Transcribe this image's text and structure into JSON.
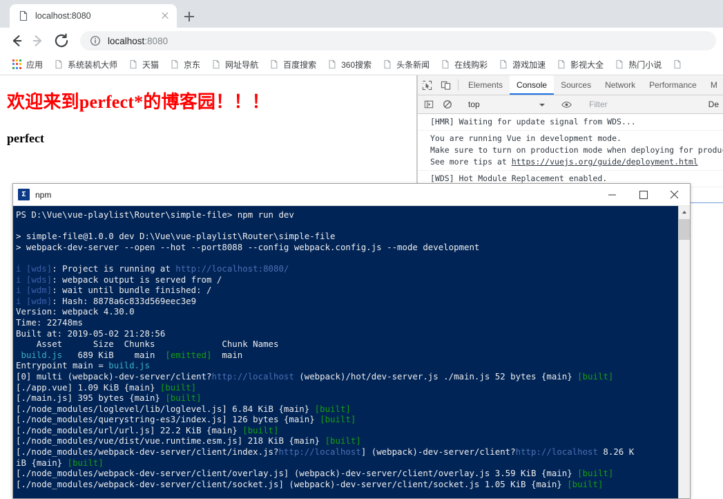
{
  "browser": {
    "tab": {
      "title": "localhost:8080",
      "favicon": "page-icon",
      "close": "close-icon"
    },
    "new_tab": "+",
    "nav": {
      "back": "back-arrow-icon",
      "forward": "forward-arrow-icon",
      "reload": "reload-icon"
    },
    "omnibox": {
      "info_icon": "info-circle-icon",
      "host": "localhost",
      "port": ":8080"
    },
    "bookmarks": [
      {
        "label": "应用",
        "icon": "apps-grid-icon"
      },
      {
        "label": "系统装机大师",
        "icon": "page-icon"
      },
      {
        "label": "天猫",
        "icon": "page-icon"
      },
      {
        "label": "京东",
        "icon": "page-icon"
      },
      {
        "label": "网址导航",
        "icon": "page-icon"
      },
      {
        "label": "百度搜索",
        "icon": "page-icon"
      },
      {
        "label": "360搜索",
        "icon": "page-icon"
      },
      {
        "label": "头条新闻",
        "icon": "page-icon"
      },
      {
        "label": "在线购彩",
        "icon": "page-icon"
      },
      {
        "label": "游戏加速",
        "icon": "page-icon"
      },
      {
        "label": "影视大全",
        "icon": "page-icon"
      },
      {
        "label": "热门小说",
        "icon": "page-icon"
      },
      {
        "label": "",
        "icon": "page-icon"
      }
    ]
  },
  "page": {
    "heading": "欢迎来到perfect*的博客园！！！",
    "subheading": "perfect",
    "heading_color": "#ff0000"
  },
  "devtools": {
    "icons": {
      "inspect": "inspect-cursor-icon",
      "device": "device-toolbar-icon",
      "sidebar": "sidebar-toggle-icon",
      "clear": "clear-console-icon",
      "eye": "eye-icon"
    },
    "tabs": [
      {
        "label": "Elements",
        "active": false
      },
      {
        "label": "Console",
        "active": true
      },
      {
        "label": "Sources",
        "active": false
      },
      {
        "label": "Network",
        "active": false
      },
      {
        "label": "Performance",
        "active": false
      },
      {
        "label": "M",
        "active": false
      }
    ],
    "context": "top",
    "filter_placeholder": "Filter",
    "levels": "De",
    "messages": [
      {
        "lines": [
          "[HMR] Waiting for update signal from WDS..."
        ]
      },
      {
        "lines": [
          "You are running Vue in development mode.",
          "Make sure to turn on production mode when deploying for producti",
          "See more tips at https://vuejs.org/guide/deployment.html"
        ],
        "link": "https://vuejs.org/guide/deployment.html"
      },
      {
        "lines": [
          "[WDS] Hot Module Replacement enabled."
        ]
      }
    ],
    "prompt": ">"
  },
  "terminal": {
    "title": "npm",
    "icon_glyph": "Σ",
    "controls": {
      "minimize": "minimize-icon",
      "maximize": "maximize-icon",
      "close": "close-icon"
    },
    "lines": [
      "PS D:\\Vue\\vue-playlist\\Router\\simple-file> npm run dev",
      "",
      "> simple-file@1.0.0 dev D:\\Vue\\vue-playlist\\Router\\simple-file",
      "> webpack-dev-server --open --hot --port8088 --config webpack.config.js --mode development",
      "",
      "i [wds]: Project is running at http://localhost:8080/",
      "i [wds]: webpack output is served from /",
      "i [wdm]: wait until bundle finished: /",
      "i [wdm]: Hash: 8878a6c833d569eec3e9",
      "Version: webpack 4.30.0",
      "Time: 22748ms",
      "Built at: 2019-05-02 21:28:56",
      "    Asset      Size  Chunks             Chunk Names",
      " build.js   689 KiB    main  [emitted]  main",
      "Entrypoint main = build.js",
      "[0] multi (webpack)-dev-server/client?http://localhost (webpack)/hot/dev-server.js ./main.js 52 bytes {main} [built]",
      "[./app.vue] 1.09 KiB {main} [built]",
      "[./main.js] 395 bytes {main} [built]",
      "[./node_modules/loglevel/lib/loglevel.js] 6.84 KiB {main} [built]",
      "[./node_modules/querystring-es3/index.js] 126 bytes {main} [built]",
      "[./node_modules/url/url.js] 22.2 KiB {main} [built]",
      "[./node_modules/vue/dist/vue.runtime.esm.js] 218 KiB {main} [built]",
      "[./node_modules/webpack-dev-server/client/index.js?http://localhost] (webpack)-dev-server/client?http://localhost 8.26 K",
      "iB {main} [built]",
      "[./node_modules/webpack-dev-server/client/overlay.js] (webpack)-dev-server/client/overlay.js 3.59 KiB {main} [built]",
      "[./node_modules/webpack-dev-server/client/socket.js] (webpack)-dev-server/client/socket.js 1.05 KiB {main} [built]"
    ],
    "scrollbar": {
      "up_arrow": "scroll-up-arrow-icon"
    }
  }
}
